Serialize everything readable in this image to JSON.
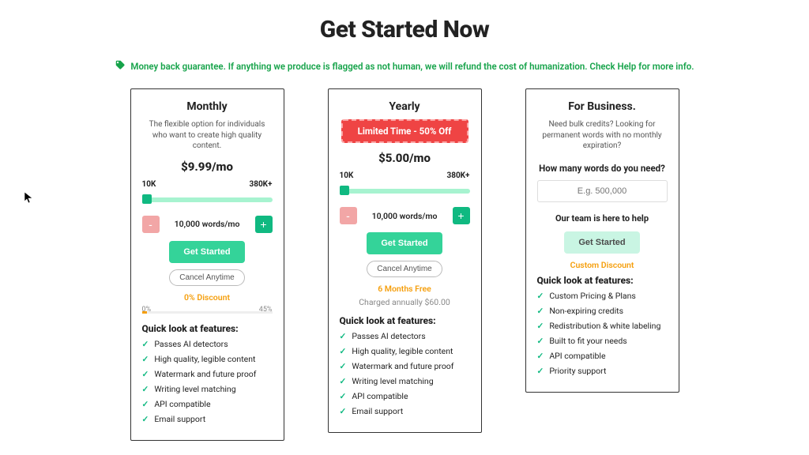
{
  "header": {
    "title": "Get Started Now",
    "guarantee": "Money back guarantee. If anything we produce is flagged as not human, we will refund the cost of humanization. Check Help for more info."
  },
  "monthly": {
    "title": "Monthly",
    "subtitle": "The flexible option for individuals who want to create high quality content.",
    "price": "$9.99/mo",
    "scale_min": "10K",
    "scale_max": "380K+",
    "minus": "-",
    "plus": "+",
    "words": "10,000 words/mo",
    "cta": "Get Started",
    "cancel": "Cancel Anytime",
    "discount": "0% Discount",
    "gauge_min": "0%",
    "gauge_max": "45%",
    "features_head": "Quick look at features:",
    "features": [
      "Passes AI detectors",
      "High quality, legible content",
      "Watermark and future proof",
      "Writing level matching",
      "API compatible",
      "Email support"
    ]
  },
  "yearly": {
    "title": "Yearly",
    "badge": "Limited Time - 50% Off",
    "price": "$5.00/mo",
    "scale_min": "10K",
    "scale_max": "380K+",
    "minus": "-",
    "plus": "+",
    "words": "10,000 words/mo",
    "cta": "Get Started",
    "cancel": "Cancel Anytime",
    "bonus": "6 Months Free",
    "charged": "Charged annually $60.00",
    "features_head": "Quick look at features:",
    "features": [
      "Passes AI detectors",
      "High quality, legible content",
      "Watermark and future proof",
      "Writing level matching",
      "API compatible",
      "Email support"
    ]
  },
  "business": {
    "title": "For Business.",
    "subtitle": "Need bulk credits? Looking for permanent words with no monthly expiration?",
    "input_label": "How many words do you need?",
    "input_placeholder": "E.g. 500,000",
    "help": "Our team is here to help",
    "cta": "Get Started",
    "discount": "Custom Discount",
    "features_head": "Quick look at features:",
    "features": [
      "Custom Pricing & Plans",
      "Non-expiring credits",
      "Redistribution & white labeling",
      "Built to fit your needs",
      "API compatible",
      "Priority support"
    ]
  }
}
